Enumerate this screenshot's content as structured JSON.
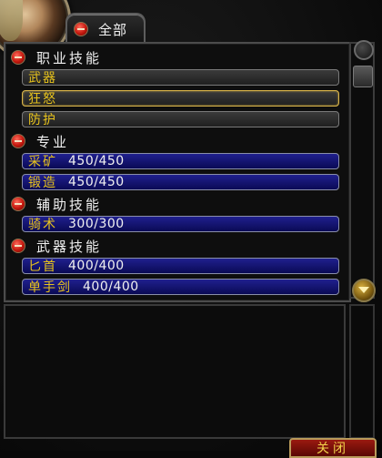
{
  "tab": {
    "label": "全部"
  },
  "categories": [
    {
      "label": "职业技能",
      "skills": [
        {
          "name": "武器",
          "value": "",
          "style": "grey",
          "selected": false
        },
        {
          "name": "狂怒",
          "value": "",
          "style": "grey",
          "selected": true
        },
        {
          "name": "防护",
          "value": "",
          "style": "grey",
          "selected": false
        }
      ]
    },
    {
      "label": "专业",
      "skills": [
        {
          "name": "采矿",
          "value": "450/450",
          "style": "blue"
        },
        {
          "name": "锻造",
          "value": "450/450",
          "style": "blue"
        }
      ]
    },
    {
      "label": "辅助技能",
      "skills": [
        {
          "name": "骑术",
          "value": "300/300",
          "style": "blue"
        }
      ]
    },
    {
      "label": "武器技能",
      "skills": [
        {
          "name": "匕首",
          "value": "400/400",
          "style": "blue"
        },
        {
          "name": "单手剑",
          "value": "400/400",
          "style": "blue"
        }
      ]
    }
  ],
  "close_button": {
    "label": "关闭"
  },
  "colors": {
    "skill_name": "#e8c31c",
    "blue_bar": "#14147a",
    "grey_bar": "#2e2e2e",
    "selected_border": "#d9b44a"
  }
}
